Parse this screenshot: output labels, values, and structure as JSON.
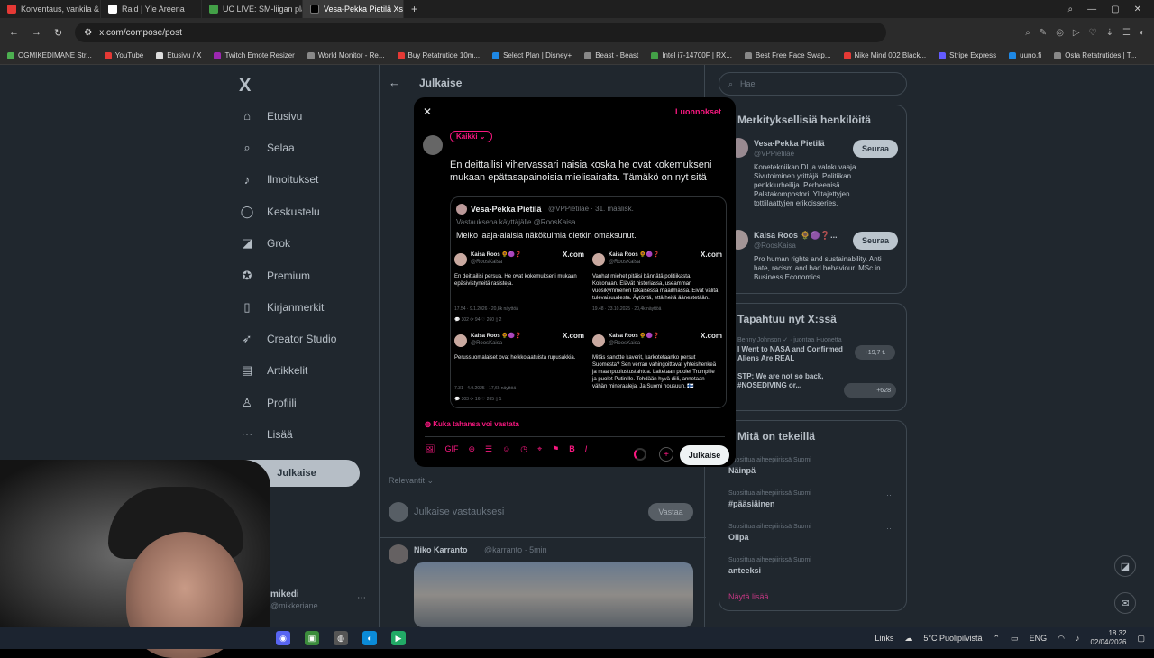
{
  "browser": {
    "tabs": [
      {
        "label": "Korventaus, vankila & tr...",
        "color": "#e53935",
        "active": false
      },
      {
        "label": "Raid | Yle Areena",
        "color": "#ffffff",
        "active": false
      },
      {
        "label": "UC LIVE: SM-liigan playoff...",
        "color": "#43a047",
        "active": false
      },
      {
        "label": "Vesa-Pekka Pietilä Xssä: ...",
        "color": "#000000",
        "active": true
      }
    ],
    "new_tab": "+",
    "url": "x.com/compose/post",
    "bookmarks": [
      {
        "label": "OGMIKEDIMANE Str...",
        "color": "#4caf50"
      },
      {
        "label": "YouTube",
        "color": "#e53935"
      },
      {
        "label": "Etusivu / X",
        "color": "#dddddd"
      },
      {
        "label": "Twitch Emote Resizer",
        "color": "#9c27b0"
      },
      {
        "label": "World Monitor - Re...",
        "color": "#888888"
      },
      {
        "label": "Buy Retatrutide 10m...",
        "color": "#e53935"
      },
      {
        "label": "Select Plan | Disney+",
        "color": "#1e88e5"
      },
      {
        "label": "Beast - Beast",
        "color": "#888888"
      },
      {
        "label": "Intel i7-14700F | RX...",
        "color": "#43a047"
      },
      {
        "label": "Best Free Face Swap...",
        "color": "#888888"
      },
      {
        "label": "Nike Mind 002 Black...",
        "color": "#e53935"
      },
      {
        "label": "Stripe Express",
        "color": "#635bff"
      },
      {
        "label": "uuno.fi",
        "color": "#1e88e5"
      },
      {
        "label": "Osta Retatrutides | T...",
        "color": "#888888"
      }
    ]
  },
  "sidebar": {
    "logo": "X",
    "items": [
      {
        "label": "Etusivu",
        "icon": "⌂"
      },
      {
        "label": "Selaa",
        "icon": "⌕"
      },
      {
        "label": "Ilmoitukset",
        "icon": "♪"
      },
      {
        "label": "Keskustelu",
        "icon": "◯"
      },
      {
        "label": "Grok",
        "icon": "◪"
      },
      {
        "label": "Premium",
        "icon": "✪"
      },
      {
        "label": "Kirjanmerkit",
        "icon": "▯"
      },
      {
        "label": "Creator Studio",
        "icon": "➶"
      },
      {
        "label": "Artikkelit",
        "icon": "▤"
      },
      {
        "label": "Profiili",
        "icon": "♙"
      },
      {
        "label": "Lisää",
        "icon": "⋯"
      }
    ],
    "post_button": "Julkaise",
    "account": {
      "name": "mikedi",
      "handle": "@mikkeriane"
    }
  },
  "center": {
    "back": "←",
    "title": "Julkaise",
    "relevant": "Relevantit ⌄",
    "reply_placeholder": "Julkaise vastauksesi",
    "reply_button": "Vastaa",
    "next_post": {
      "name": "Niko Karranto",
      "meta": "@karranto · 5min"
    }
  },
  "right": {
    "search_placeholder": "Hae",
    "who_title": "Merkityksellisiä henkilöitä",
    "people": [
      {
        "name": "Vesa-Pekka Pietilä",
        "handle": "@VPPietilae",
        "bio": "Konetekniikan DI ja valokuvaaja. Sivutoiminen yrittäjä. Politiikan penkkiurheilija. Perheenisä. Palstakompostori. Ylitajettyjen tottiilaattyjen erikoisseries.",
        "follow": "Seuraa"
      },
      {
        "name": "Kaisa Roos 🌻🟣❓...",
        "handle": "@RoosKaisa",
        "bio": "Pro human rights and sustainability. Anti hate, racism and bad behaviour. MSc in Business Economics.",
        "follow": "Seuraa"
      }
    ],
    "now_title": "Tapahtuu nyt X:ssä",
    "now_items": [
      {
        "head": "Benny Johnson ✓ · juontaa Huonetta",
        "text": "I Went to NASA and Confirmed Aliens Are REAL",
        "count": "+19,7 t."
      },
      {
        "head": "",
        "text": "STP: We are not so back, #NOSEDIVING or...",
        "count": "+628"
      }
    ],
    "trends_title": "Mitä on tekeillä",
    "trends": [
      {
        "meta": "Suosittua aiheepiirissä Suomi",
        "name": "Näinpä"
      },
      {
        "meta": "Suosittua aiheepiirissä Suomi",
        "name": "#pääsiäinen"
      },
      {
        "meta": "Suosittua aiheepiirissä Suomi",
        "name": "Olipa"
      },
      {
        "meta": "Suosittua aiheepiirissä Suomi",
        "name": "anteeksi"
      }
    ],
    "show_more": "Näytä lisää"
  },
  "modal": {
    "close": "✕",
    "drafts": "Luonnokset",
    "audience": "Kaikki ⌄",
    "text": "En deittailisi vihervassari naisia koska he ovat kokemukseni mukaan epätasapainoisia mielisairaita. Tämäkö on nyt sitä",
    "quote": {
      "name": "Vesa-Pekka Pietilä",
      "meta": "@VPPietilae · 31. maalisk.",
      "reply_to": "Vastauksena käyttäjälle @RoosKaisa",
      "text": "Melko laaja-alaisia näkökulmia oletkin omaksunut.",
      "shots": [
        {
          "name": "Kaisa Roos 🌻🟣❓",
          "handle": "@RoosKaisa",
          "text": "En deittailisi persua. He ovat kokemukseni mukaan epäsivistyneitä rasisteja.",
          "meta": "17.54 · 9.1.2026 · 20,8k näyttöä",
          "stats": "💬 302   ⟳ 94   ♡ 260   ▯ 2"
        },
        {
          "name": "Kaisa Roos 🌻🟣❓",
          "handle": "@RoosKaisa",
          "text": "Vanhat miehet pitäisi bännätä politiikasta. Kokonaan. Elävät historiassa, useamman vuosikymmenen takaisessa maailmassa. Eivät välitä tulevaisuudesta. Äytöntä, että heitä äänestetään.",
          "meta": "19.48 · 23.10.2025 · 20,4k näyttöä",
          "stats": ""
        },
        {
          "name": "Kaisa Roos 🌻🟣❓",
          "handle": "@RoosKaisa",
          "text": "Perussuomalaiset ovat heikkolaatuista rupusakkia.",
          "meta": "7.31 · 4.9.2025 · 17,6k näyttöä",
          "stats": "💬 303   ⟳ 16   ♡ 265   ▯ 1"
        },
        {
          "name": "Kaisa Roos 🌻🟣❓",
          "handle": "@RoosKaisa",
          "text": "Mitäs sanotte kaverit, karkotetaanko persut Suomesta? Sen verran vahingoittavat yhteishenkeä ja maanpuolustustahtoa. Laitetaan puolet Trumpille ja puolet Putinille. Tehdään hyvä diili, annetaan vähän mineraaleja. Ja Suomi nousuun. 🇫🇮",
          "meta": "",
          "stats": ""
        }
      ],
      "x_label": "X.com"
    },
    "reply_setting": "Kuka tahansa voi vastata",
    "toolbar_icons": [
      "🖼",
      "GIF",
      "⊕",
      "☰",
      "☺",
      "◷",
      "⌖",
      "⚑",
      "B",
      "I"
    ],
    "publish": "Julkaise"
  },
  "taskbar": {
    "links": "Links",
    "weather": "5°C Puolipilvistä",
    "lang": "ENG",
    "time": "18.32",
    "date": "02/04/2026"
  }
}
